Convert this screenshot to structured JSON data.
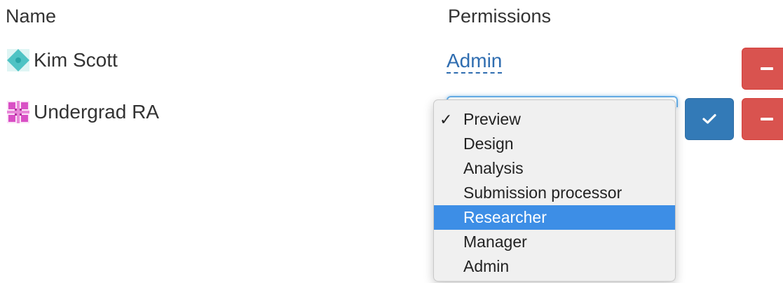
{
  "headers": {
    "name": "Name",
    "permissions": "Permissions"
  },
  "rows": [
    {
      "name": "Kim Scott",
      "permission": "Admin",
      "avatar_color": "#4fc3c4",
      "remove_icon": "minus-icon"
    },
    {
      "name": "Undergrad RA",
      "avatar_color": "#d94fc5",
      "confirm_icon": "check-icon",
      "remove_icon": "minus-icon"
    }
  ],
  "dropdown": {
    "selected": "Preview",
    "highlighted": "Researcher",
    "options": [
      "Preview",
      "Design",
      "Analysis",
      "Submission processor",
      "Researcher",
      "Manager",
      "Admin"
    ]
  },
  "colors": {
    "danger": "#d9534f",
    "primary": "#337ab7",
    "link": "#2f6db0",
    "highlight": "#3d8ee6"
  }
}
